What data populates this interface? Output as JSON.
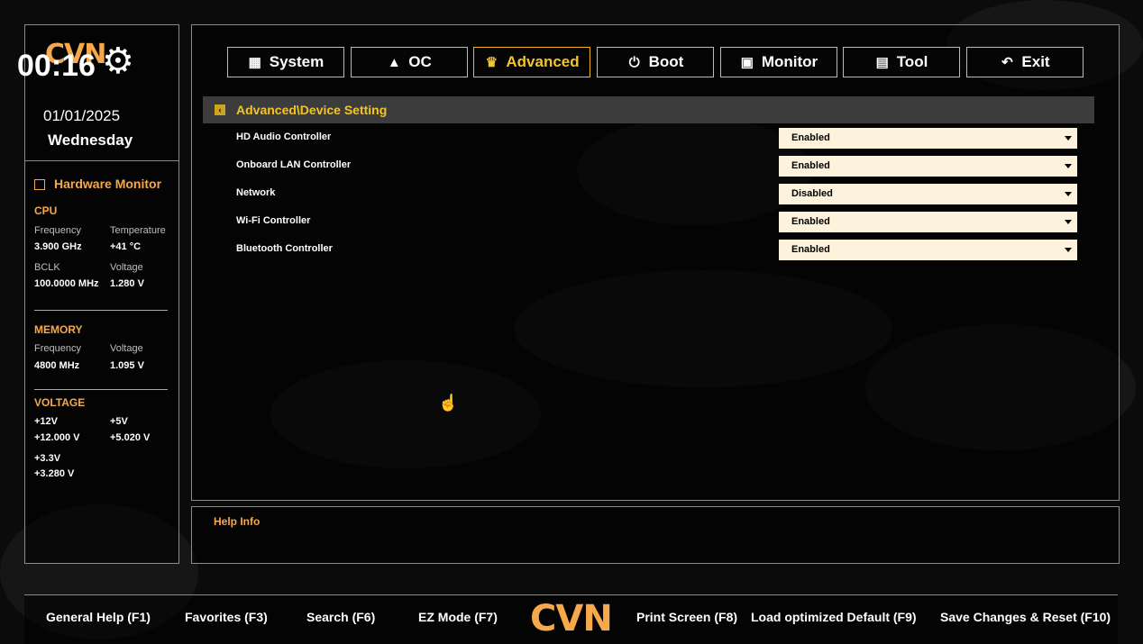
{
  "brand": {
    "logo_text": "CVN",
    "accent_color": "#f6a94a",
    "tab_active_color": "#f2c52a"
  },
  "clock": {
    "time": "00:16",
    "date": "01/01/2025",
    "weekday": "Wednesday",
    "icon": "gear-icon"
  },
  "hardware_monitor": {
    "title": "Hardware Monitor",
    "cpu": {
      "heading": "CPU",
      "frequency_label": "Frequency",
      "frequency": "3.900 GHz",
      "temperature_label": "Temperature",
      "temperature": "+41 °C",
      "bclk_label": "BCLK",
      "bclk": "100.0000 MHz",
      "voltage_label": "Voltage",
      "voltage": "1.280 V"
    },
    "memory": {
      "heading": "MEMORY",
      "frequency_label": "Frequency",
      "frequency": "4800 MHz",
      "voltage_label": "Voltage",
      "voltage": "1.095 V"
    },
    "voltage": {
      "heading": "VOLTAGE",
      "v12_label": "+12V",
      "v12": "+12.000 V",
      "v5_label": "+5V",
      "v5": "+5.020 V",
      "v33_label": "+3.3V",
      "v33": "+3.280 V"
    }
  },
  "tabs": [
    {
      "label": "System",
      "icon": "grid-icon",
      "active": false
    },
    {
      "label": "OC",
      "icon": "rocket-icon",
      "active": false
    },
    {
      "label": "Advanced",
      "icon": "crown-icon",
      "active": true
    },
    {
      "label": "Boot",
      "icon": "power-icon",
      "active": false
    },
    {
      "label": "Monitor",
      "icon": "pulse-icon",
      "active": false
    },
    {
      "label": "Tool",
      "icon": "toolbox-icon",
      "active": false
    },
    {
      "label": "Exit",
      "icon": "back-arrow-icon",
      "active": false
    }
  ],
  "breadcrumb": "Advanced\\Device Setting",
  "settings": [
    {
      "label": "HD Audio Controller",
      "value": "Enabled"
    },
    {
      "label": "Onboard LAN Controller",
      "value": "Enabled"
    },
    {
      "label": "Network",
      "value": "Disabled"
    },
    {
      "label": "Wi-Fi Controller",
      "value": "Enabled"
    },
    {
      "label": "Bluetooth Controller",
      "value": "Enabled"
    }
  ],
  "help": {
    "title": "Help Info"
  },
  "footer": {
    "general_help": "General Help (F1)",
    "favorites": "Favorites (F3)",
    "search": "Search (F6)",
    "ez_mode": "EZ Mode (F7)",
    "print_screen": "Print Screen (F8)",
    "load_default": "Load optimized Default (F9)",
    "save_reset": "Save Changes & Reset (F10)"
  }
}
